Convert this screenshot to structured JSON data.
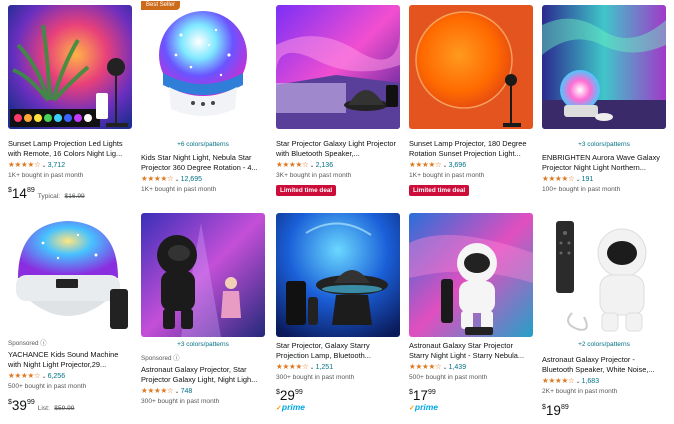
{
  "products": [
    {
      "title": "Sunset Lamp Projection Led Lights with Remote, 16 Colors Night Lig...",
      "stars": "★★★★☆",
      "rating_count": "3,712",
      "bought": "1K+ bought in past month",
      "price_cur": "$",
      "price_whole": "14",
      "price_cents": "89",
      "old_label": "Typical:",
      "old_price": "$16.99"
    },
    {
      "badge": "Best Seller",
      "swatch_link": "+6 colors/patterns",
      "title": "Kids Star Night Light, Nebula Star Projector 360 Degree Rotation - 4...",
      "stars": "★★★★☆",
      "rating_count": "12,695",
      "bought": "1K+ bought in past month"
    },
    {
      "title": "Star Projector Galaxy Light Projector with Bluetooth Speaker,...",
      "stars": "★★★★☆",
      "rating_count": "2,136",
      "bought": "3K+ bought in past month",
      "deal": "Limited time deal"
    },
    {
      "title": "Sunset Lamp Projector, 180 Degree Rotation Sunset Projection Light...",
      "stars": "★★★★☆",
      "rating_count": "3,696",
      "bought": "1K+ bought in past month",
      "deal": "Limited time deal"
    },
    {
      "swatch_link": "+3 colors/patterns",
      "title": "ENBRIGHTEN Aurora Wave Galaxy Projector Night Light Northern...",
      "stars": "★★★★☆",
      "rating_count": "191",
      "bought": "100+ bought in past month"
    },
    {
      "sponsored": "Sponsored ⓘ",
      "title": "YACHANCE Kids Sound Machine with Night Light Projector,29...",
      "stars": "★★★★☆",
      "rating_count": "6,256",
      "bought": "500+ bought in past month",
      "price_cur": "$",
      "price_whole": "39",
      "price_cents": "99",
      "old_label": "List:",
      "old_price": "$59.99"
    },
    {
      "swatch_link": "+3 colors/patterns",
      "sponsored": "Sponsored ⓘ",
      "title": "Astronaut Galaxy Projector, Star Projector Galaxy Light, Night Ligh...",
      "stars": "★★★★☆",
      "rating_count": "748",
      "bought": "300+ bought in past month"
    },
    {
      "title": "Star Projector, Galaxy Starry Projection Lamp, Bluetooth...",
      "stars": "★★★★☆",
      "rating_count": "1,251",
      "bought": "300+ bought in past month",
      "price_cur": "$",
      "price_whole": "29",
      "price_cents": "99",
      "prime": "prime"
    },
    {
      "title": "Astronaut Galaxy Star Projector Starry Night Light - Starry Nebula...",
      "stars": "★★★★☆",
      "rating_count": "1,439",
      "bought": "500+ bought in past month",
      "price_cur": "$",
      "price_whole": "17",
      "price_cents": "99",
      "prime": "prime"
    },
    {
      "swatch_link": "+2 colors/patterns",
      "title": "Astronaut Galaxy Projector - Bluetooth Speaker, White Noise,...",
      "stars": "★★★★☆",
      "rating_count": "1,683",
      "bought": "2K+ bought in past month",
      "price_cur": "$",
      "price_whole": "19",
      "price_cents": "89"
    }
  ],
  "colors": {
    "star": "#DE7921",
    "link": "#007185",
    "deal": "#CC0C39",
    "best_seller": "#CC6B1A",
    "prime": "#00A8E1"
  }
}
